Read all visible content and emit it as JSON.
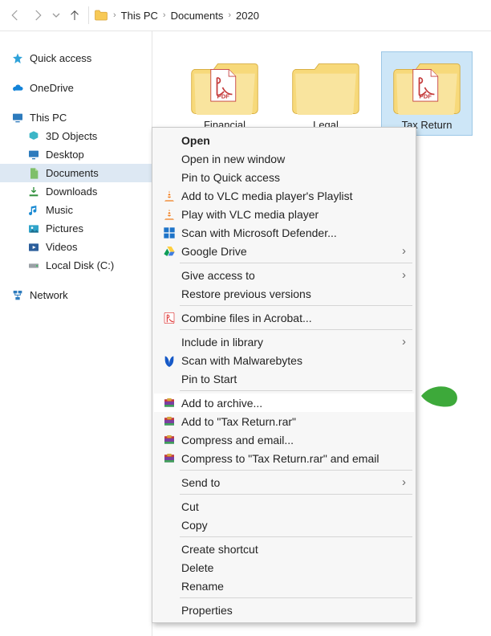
{
  "nav": {
    "crumbs": [
      "This PC",
      "Documents",
      "2020"
    ]
  },
  "sidebar": {
    "quick_access": "Quick access",
    "onedrive": "OneDrive",
    "this_pc": "This PC",
    "network": "Network",
    "children": {
      "objects3d": "3D Objects",
      "desktop": "Desktop",
      "documents": "Documents",
      "downloads": "Downloads",
      "music": "Music",
      "pictures": "Pictures",
      "videos": "Videos",
      "local_disk": "Local Disk (C:)"
    }
  },
  "folders": [
    {
      "label": "Financial"
    },
    {
      "label": "Legal"
    },
    {
      "label": "Tax Return"
    }
  ],
  "context_menu": {
    "open": "Open",
    "open_new_window": "Open in new window",
    "pin_quick_access": "Pin to Quick access",
    "add_vlc_playlist": "Add to VLC media player's Playlist",
    "play_vlc": "Play with VLC media player",
    "scan_defender": "Scan with Microsoft Defender...",
    "google_drive": "Google Drive",
    "give_access": "Give access to",
    "restore_versions": "Restore previous versions",
    "combine_acrobat": "Combine files in Acrobat...",
    "include_library": "Include in library",
    "scan_malwarebytes": "Scan with Malwarebytes",
    "pin_start": "Pin to Start",
    "add_archive": "Add to archive...",
    "add_rar": "Add to \"Tax Return.rar\"",
    "compress_email": "Compress and email...",
    "compress_rar_email": "Compress to \"Tax Return.rar\" and email",
    "send_to": "Send to",
    "cut": "Cut",
    "copy": "Copy",
    "create_shortcut": "Create shortcut",
    "delete": "Delete",
    "rename": "Rename",
    "properties": "Properties"
  }
}
